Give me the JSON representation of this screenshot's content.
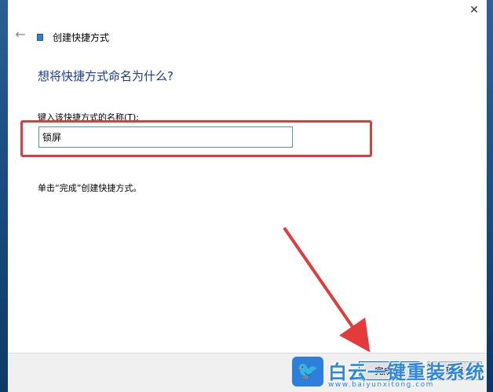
{
  "window": {
    "title": "创建快捷方式",
    "close_glyph": "✕",
    "back_glyph": "←"
  },
  "main": {
    "heading": "想将快捷方式命名为什么?",
    "field_label": "键入该快捷方式的名称(T):",
    "name_value": "锁屏",
    "instruction": "单击“完成”创建快捷方式。"
  },
  "footer": {
    "finish_label": "完成(F)",
    "cancel_label": "取消"
  },
  "watermark": {
    "logo_glyph": "🐦",
    "title": "白云一键重装系统",
    "url": "www.baiyunxitong.com"
  },
  "colors": {
    "heading": "#1a3aa0",
    "highlight": "#e33b3b",
    "input_border": "#5a8fcf",
    "watermark": "#2f86e0"
  },
  "icons": {
    "close": "close-icon",
    "back": "back-arrow-icon",
    "shortcut": "shortcut-icon"
  }
}
